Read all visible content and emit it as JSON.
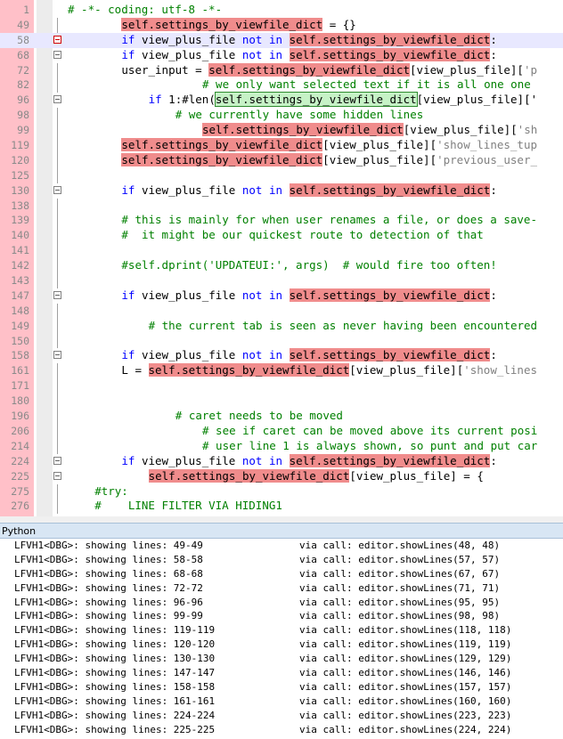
{
  "editor": {
    "lines": [
      {
        "n": "1",
        "indent": 0,
        "segs": [
          [
            "cm",
            "# -*- coding: utf-8 -*-"
          ]
        ],
        "fold": "none"
      },
      {
        "n": "49",
        "indent": 8,
        "segs": [
          [
            "hl",
            "self.settings_by_viewfile_dict"
          ],
          [
            "t",
            " = {}"
          ]
        ],
        "fold": "line"
      },
      {
        "n": "58",
        "indent": 8,
        "segs": [
          [
            "kw",
            "if"
          ],
          [
            "t",
            " view_plus_file "
          ],
          [
            "kw",
            "not in"
          ],
          [
            "t",
            " "
          ],
          [
            "hl",
            "self.settings_by_viewfile_dict"
          ],
          [
            "t",
            ":"
          ]
        ],
        "fold": "box-red",
        "current": true
      },
      {
        "n": "68",
        "indent": 8,
        "segs": [
          [
            "kw",
            "if"
          ],
          [
            "t",
            " view_plus_file "
          ],
          [
            "kw",
            "not in"
          ],
          [
            "t",
            " "
          ],
          [
            "hl",
            "self.settings_by_viewfile_dict"
          ],
          [
            "t",
            ":"
          ]
        ],
        "fold": "box"
      },
      {
        "n": "72",
        "indent": 8,
        "segs": [
          [
            "t",
            "user_input = "
          ],
          [
            "hl",
            "self.settings_by_viewfile_dict"
          ],
          [
            "t",
            "[view_plus_file]["
          ],
          [
            "st",
            "'p"
          ]
        ],
        "fold": "line"
      },
      {
        "n": "82",
        "indent": 20,
        "segs": [
          [
            "cm",
            "# we only want selected text if it is all one one"
          ]
        ],
        "fold": "line"
      },
      {
        "n": "96",
        "indent": 12,
        "segs": [
          [
            "kw",
            "if"
          ],
          [
            "t",
            " 1:#len("
          ],
          [
            "hlg",
            "self.settings_by_viewfile_dict"
          ],
          [
            "t",
            "[view_plus_file]['"
          ]
        ],
        "fold": "box"
      },
      {
        "n": "98",
        "indent": 16,
        "segs": [
          [
            "cm",
            "# we currently have some hidden lines"
          ]
        ],
        "fold": "line"
      },
      {
        "n": "99",
        "indent": 20,
        "segs": [
          [
            "hl",
            "self.settings_by_viewfile_dict"
          ],
          [
            "t",
            "[view_plus_file]["
          ],
          [
            "st",
            "'sh"
          ]
        ],
        "fold": "line"
      },
      {
        "n": "119",
        "indent": 8,
        "segs": [
          [
            "hl",
            "self.settings_by_viewfile_dict"
          ],
          [
            "t",
            "[view_plus_file]["
          ],
          [
            "st",
            "'show_lines_tup"
          ]
        ],
        "fold": "line"
      },
      {
        "n": "120",
        "indent": 8,
        "segs": [
          [
            "hl",
            "self.settings_by_viewfile_dict"
          ],
          [
            "t",
            "[view_plus_file]["
          ],
          [
            "st",
            "'previous_user_"
          ]
        ],
        "fold": "line"
      },
      {
        "n": "125",
        "indent": 0,
        "segs": [],
        "fold": "line"
      },
      {
        "n": "130",
        "indent": 8,
        "segs": [
          [
            "kw",
            "if"
          ],
          [
            "t",
            " view_plus_file "
          ],
          [
            "kw",
            "not in"
          ],
          [
            "t",
            " "
          ],
          [
            "hl",
            "self.settings_by_viewfile_dict"
          ],
          [
            "t",
            ":"
          ]
        ],
        "fold": "box"
      },
      {
        "n": "138",
        "indent": 0,
        "segs": [],
        "fold": "line"
      },
      {
        "n": "139",
        "indent": 8,
        "segs": [
          [
            "cm",
            "# this is mainly for when user renames a file, or does a save-"
          ]
        ],
        "fold": "line"
      },
      {
        "n": "140",
        "indent": 8,
        "segs": [
          [
            "cm",
            "#  it might be our quickest route to detection of that"
          ]
        ],
        "fold": "line"
      },
      {
        "n": "141",
        "indent": 0,
        "segs": [],
        "fold": "line"
      },
      {
        "n": "142",
        "indent": 8,
        "segs": [
          [
            "cm",
            "#self.dprint('UPDATEUI:', args)  # would fire too often!"
          ]
        ],
        "fold": "line"
      },
      {
        "n": "143",
        "indent": 0,
        "segs": [],
        "fold": "line"
      },
      {
        "n": "147",
        "indent": 8,
        "segs": [
          [
            "kw",
            "if"
          ],
          [
            "t",
            " view_plus_file "
          ],
          [
            "kw",
            "not in"
          ],
          [
            "t",
            " "
          ],
          [
            "hl",
            "self.settings_by_viewfile_dict"
          ],
          [
            "t",
            ":"
          ]
        ],
        "fold": "box"
      },
      {
        "n": "148",
        "indent": 0,
        "segs": [],
        "fold": "line"
      },
      {
        "n": "149",
        "indent": 12,
        "segs": [
          [
            "cm",
            "# the current tab is seen as never having been encountered"
          ]
        ],
        "fold": "line"
      },
      {
        "n": "150",
        "indent": 0,
        "segs": [],
        "fold": "line"
      },
      {
        "n": "158",
        "indent": 8,
        "segs": [
          [
            "kw",
            "if"
          ],
          [
            "t",
            " view_plus_file "
          ],
          [
            "kw",
            "not in"
          ],
          [
            "t",
            " "
          ],
          [
            "hl",
            "self.settings_by_viewfile_dict"
          ],
          [
            "t",
            ":"
          ]
        ],
        "fold": "box"
      },
      {
        "n": "161",
        "indent": 8,
        "segs": [
          [
            "t",
            "L = "
          ],
          [
            "hl",
            "self.settings_by_viewfile_dict"
          ],
          [
            "t",
            "[view_plus_file]["
          ],
          [
            "st",
            "'show_lines"
          ]
        ],
        "fold": "line"
      },
      {
        "n": "171",
        "indent": 0,
        "segs": [],
        "fold": "line"
      },
      {
        "n": "180",
        "indent": 0,
        "segs": [],
        "fold": "line"
      },
      {
        "n": "196",
        "indent": 16,
        "segs": [
          [
            "cm",
            "# caret needs to be moved"
          ]
        ],
        "fold": "line"
      },
      {
        "n": "206",
        "indent": 20,
        "segs": [
          [
            "cm",
            "# see if caret can be moved above its current posi"
          ]
        ],
        "fold": "line"
      },
      {
        "n": "214",
        "indent": 20,
        "segs": [
          [
            "cm",
            "# user line 1 is always shown, so punt and put car"
          ]
        ],
        "fold": "line"
      },
      {
        "n": "224",
        "indent": 8,
        "segs": [
          [
            "kw",
            "if"
          ],
          [
            "t",
            " view_plus_file "
          ],
          [
            "kw",
            "not in"
          ],
          [
            "t",
            " "
          ],
          [
            "hl",
            "self.settings_by_viewfile_dict"
          ],
          [
            "t",
            ":"
          ]
        ],
        "fold": "box"
      },
      {
        "n": "225",
        "indent": 12,
        "segs": [
          [
            "hl",
            "self.settings_by_viewfile_dict"
          ],
          [
            "t",
            "[view_plus_file] = {"
          ]
        ],
        "fold": "box"
      },
      {
        "n": "275",
        "indent": 4,
        "segs": [
          [
            "cm",
            "#try:"
          ]
        ],
        "fold": "line"
      },
      {
        "n": "276",
        "indent": 4,
        "segs": [
          [
            "cm",
            "#    LINE FILTER VIA HIDING1"
          ]
        ],
        "fold": "line"
      }
    ]
  },
  "console": {
    "title": "Python",
    "lines": [
      {
        "left": "LFVH1<DBG>: showing lines: 49-49",
        "right": "via call: editor.showLines(48, 48)"
      },
      {
        "left": "LFVH1<DBG>: showing lines: 58-58",
        "right": "via call: editor.showLines(57, 57)"
      },
      {
        "left": "LFVH1<DBG>: showing lines: 68-68",
        "right": "via call: editor.showLines(67, 67)"
      },
      {
        "left": "LFVH1<DBG>: showing lines: 72-72",
        "right": "via call: editor.showLines(71, 71)"
      },
      {
        "left": "LFVH1<DBG>: showing lines: 96-96",
        "right": "via call: editor.showLines(95, 95)"
      },
      {
        "left": "LFVH1<DBG>: showing lines: 99-99",
        "right": "via call: editor.showLines(98, 98)"
      },
      {
        "left": "LFVH1<DBG>: showing lines: 119-119",
        "right": "via call: editor.showLines(118, 118)"
      },
      {
        "left": "LFVH1<DBG>: showing lines: 120-120",
        "right": "via call: editor.showLines(119, 119)"
      },
      {
        "left": "LFVH1<DBG>: showing lines: 130-130",
        "right": "via call: editor.showLines(129, 129)"
      },
      {
        "left": "LFVH1<DBG>: showing lines: 147-147",
        "right": "via call: editor.showLines(146, 146)"
      },
      {
        "left": "LFVH1<DBG>: showing lines: 158-158",
        "right": "via call: editor.showLines(157, 157)"
      },
      {
        "left": "LFVH1<DBG>: showing lines: 161-161",
        "right": "via call: editor.showLines(160, 160)"
      },
      {
        "left": "LFVH1<DBG>: showing lines: 224-224",
        "right": "via call: editor.showLines(223, 223)"
      },
      {
        "left": "LFVH1<DBG>: showing lines: 225-225",
        "right": "via call: editor.showLines(224, 224)"
      }
    ]
  },
  "colors": {
    "gutter": "#ffc0c8",
    "highlight": "#f08c8c",
    "keyword": "#0000ff",
    "comment": "#008000"
  }
}
